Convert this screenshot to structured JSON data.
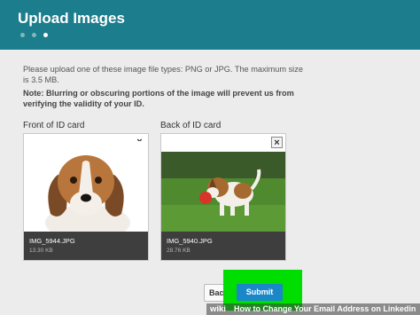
{
  "header": {
    "title": "Upload Images",
    "steps": [
      {
        "state": "inactive"
      },
      {
        "state": "inactive"
      },
      {
        "state": "active"
      }
    ]
  },
  "instructions": {
    "description": "Please upload one of these image file types: PNG or JPG. The maximum size is 3.5 MB.",
    "note": "Note: Blurring or obscuring portions of the image will prevent us from verifying the validity of your ID."
  },
  "cards": [
    {
      "label": "Front of ID card",
      "file_name": "IMG_5944.JPG",
      "file_size": "13.30 KB",
      "close_icon": "×"
    },
    {
      "label": "Back of ID card",
      "file_name": "IMG_5940.JPG",
      "file_size": "28.76 KB",
      "close_icon": "×"
    }
  ],
  "actions": {
    "back_label": "Bac",
    "submit_label": "Submit"
  },
  "watermark": {
    "logo": "wiki",
    "caption": "How to Change Your Email Address on Linkedin"
  },
  "colors": {
    "header": "#1c7d8c",
    "submit": "#1a87c9",
    "highlight": "#00dd00"
  }
}
